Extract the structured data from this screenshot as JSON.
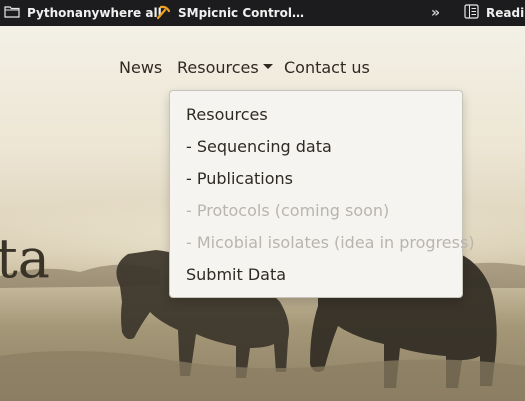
{
  "bookmarks_bar": {
    "items": [
      {
        "label": "Pythonanywhere all",
        "icon": "folder-icon"
      },
      {
        "label": "SMpicnic Control…",
        "icon": "pickaxe-icon"
      },
      {
        "label": "Readin",
        "icon": "reading-list-icon"
      }
    ],
    "overflow_label": "»"
  },
  "nav": {
    "news": "News",
    "resources": "Resources",
    "contact": "Contact us"
  },
  "dropdown": {
    "items": [
      {
        "label": "Resources",
        "disabled": false
      },
      {
        "label": "- Sequencing data",
        "disabled": false
      },
      {
        "label": "- Publications",
        "disabled": false
      },
      {
        "label": "- Protocols (coming soon)",
        "disabled": true
      },
      {
        "label": "- Micobial isolates (idea in progress)",
        "disabled": true
      },
      {
        "label": "Submit Data",
        "disabled": false
      }
    ]
  },
  "hero": {
    "title_fragment": "ta"
  },
  "colors": {
    "bookmarks_bg": "#1c1c1e",
    "text": "#2f2a22",
    "dropdown_bg": "#f5f4f0",
    "disabled_text": "#b9b5ad",
    "pickaxe_icon": "#f0a020"
  }
}
